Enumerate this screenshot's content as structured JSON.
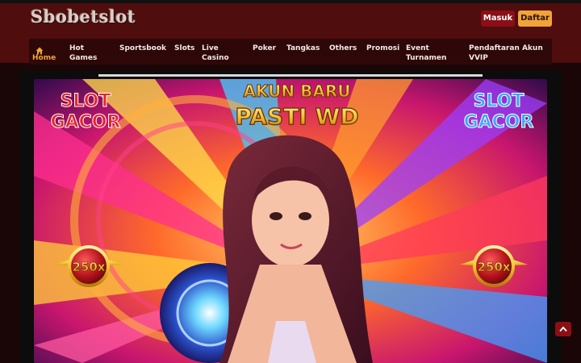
{
  "site": {
    "brand": "Sbobetslot"
  },
  "header": {
    "login_label": "Masuk",
    "register_label": "Daftar"
  },
  "nav": {
    "items": [
      {
        "label": "Home",
        "icon": "home-icon"
      },
      {
        "label": "Hot Games"
      },
      {
        "label": "Sportsbook"
      },
      {
        "label": "Slots"
      },
      {
        "label": "Live Casino"
      },
      {
        "label": "Poker"
      },
      {
        "label": "Tangkas"
      },
      {
        "label": "Others"
      },
      {
        "label": "Promosi"
      },
      {
        "label": "Event Turnamen"
      },
      {
        "label": "Pendaftaran Akun VVIP"
      }
    ]
  },
  "banner": {
    "headline_line1": "AKUN BARU",
    "headline_line2": "PASTI WD",
    "left_badge_line1": "SLOT",
    "left_badge_line2": "GACOR",
    "right_badge_line1": "SLOT",
    "right_badge_line2": "GACOR",
    "multiplier_left": "250x",
    "multiplier_right": "250x"
  },
  "scroll_top": {
    "icon": "chevron-up-icon"
  },
  "colors": {
    "header_bg": "#500d0d",
    "nav_bg": "#2e0808",
    "accent": "#f0a43a",
    "button_red": "#8b0f16"
  }
}
